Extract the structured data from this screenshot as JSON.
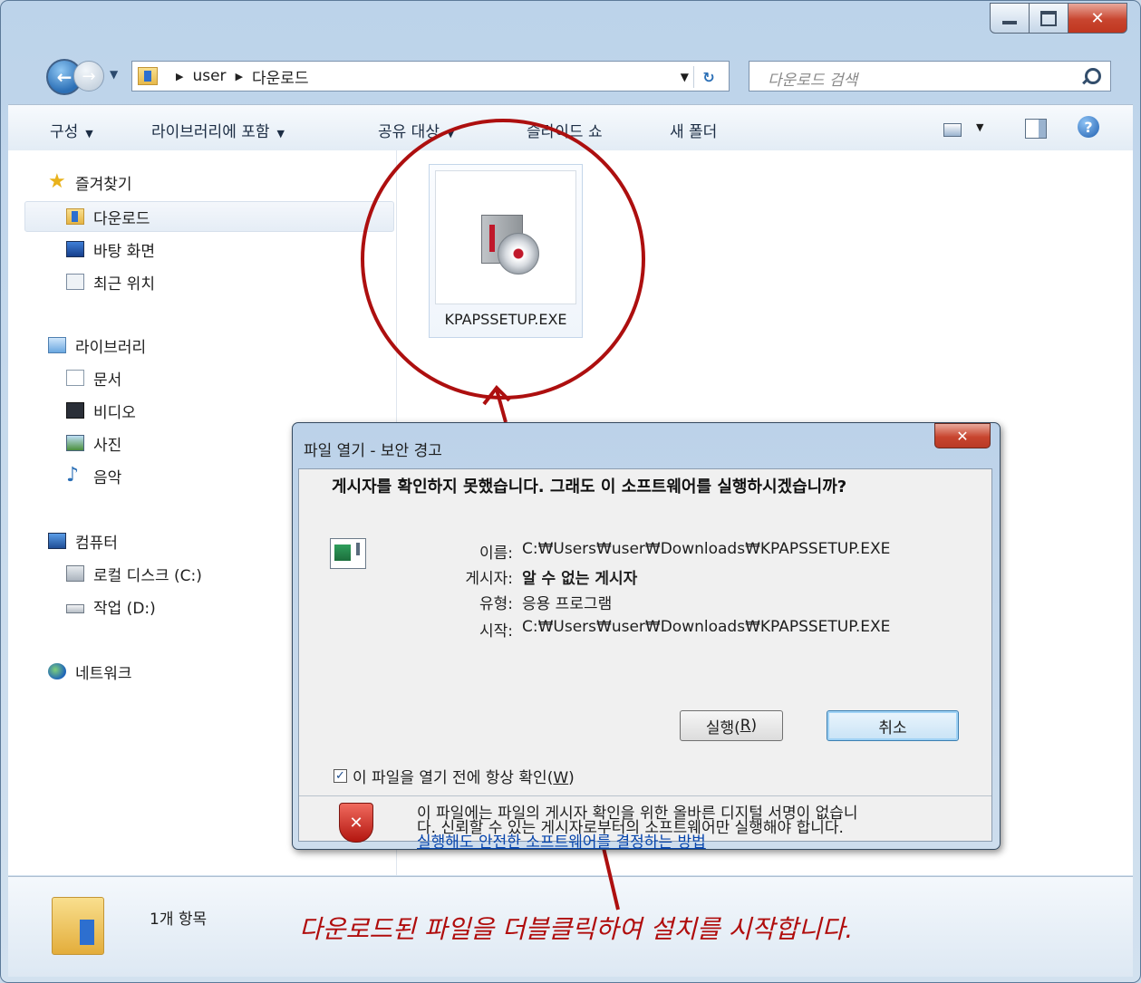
{
  "window": {
    "controls": {
      "minimize": "minimize",
      "maximize": "maximize",
      "close": "✕"
    }
  },
  "address_bar": {
    "breadcrumbs": [
      "user",
      "다운로드"
    ],
    "search_placeholder": "다운로드 검색"
  },
  "toolbar": {
    "items": [
      "구성",
      "라이브러리에 포함",
      "공유 대상",
      "슬라이드 쇼",
      "새 폴더"
    ],
    "help_label": "?"
  },
  "nav": {
    "favorites": {
      "label": "즐겨찾기",
      "items": [
        "다운로드",
        "바탕 화면",
        "최근 위치"
      ]
    },
    "libraries": {
      "label": "라이브러리",
      "items": [
        "문서",
        "비디오",
        "사진",
        "음악"
      ]
    },
    "computer": {
      "label": "컴퓨터",
      "items": [
        "로컬 디스크 (C:)",
        "작업 (D:)"
      ]
    },
    "network": {
      "label": "네트워크"
    }
  },
  "file": {
    "name": "KPAPSSETUP.EXE"
  },
  "status": {
    "count": "1개 항목"
  },
  "dialog": {
    "title": "파일 열기 - 보안 경고",
    "heading": "게시자를 확인하지 못했습니다.  그래도 이 소프트웨어를 실행하시겠습니까?",
    "fields": [
      {
        "key": "이름:",
        "value": "C:₩Users₩user₩Downloads₩KPAPSSETUP.EXE"
      },
      {
        "key": "게시자:",
        "value": "알 수 없는 게시자"
      },
      {
        "key": "유형:",
        "value": "응용 프로그램"
      },
      {
        "key": "시작:",
        "value": "C:₩Users₩user₩Downloads₩KPAPSSETUP.EXE"
      }
    ],
    "run_button": {
      "text": "실행(",
      "mnemonic": "R",
      "end": ")"
    },
    "cancel_button": "취소",
    "checkbox": {
      "text": "이 파일을 열기 전에 항상 확인(",
      "mnemonic": "W",
      "end": ")",
      "checked": true
    },
    "warning_line1": "이 파일에는 파일의 게시자 확인을 위한 올바른 디지털 서명이 없습니",
    "warning_line2": "다.  신뢰할 수 있는 게시자로부터의 소프트웨어만 실행해야 합니다.",
    "warning_link": "실행해도 안전한 소프트웨어를 결정하는 방법"
  },
  "annotation": {
    "caption": "다운로드된 파일을 더블클릭하여 설치를 시작합니다.",
    "color": "#b00c0c"
  }
}
